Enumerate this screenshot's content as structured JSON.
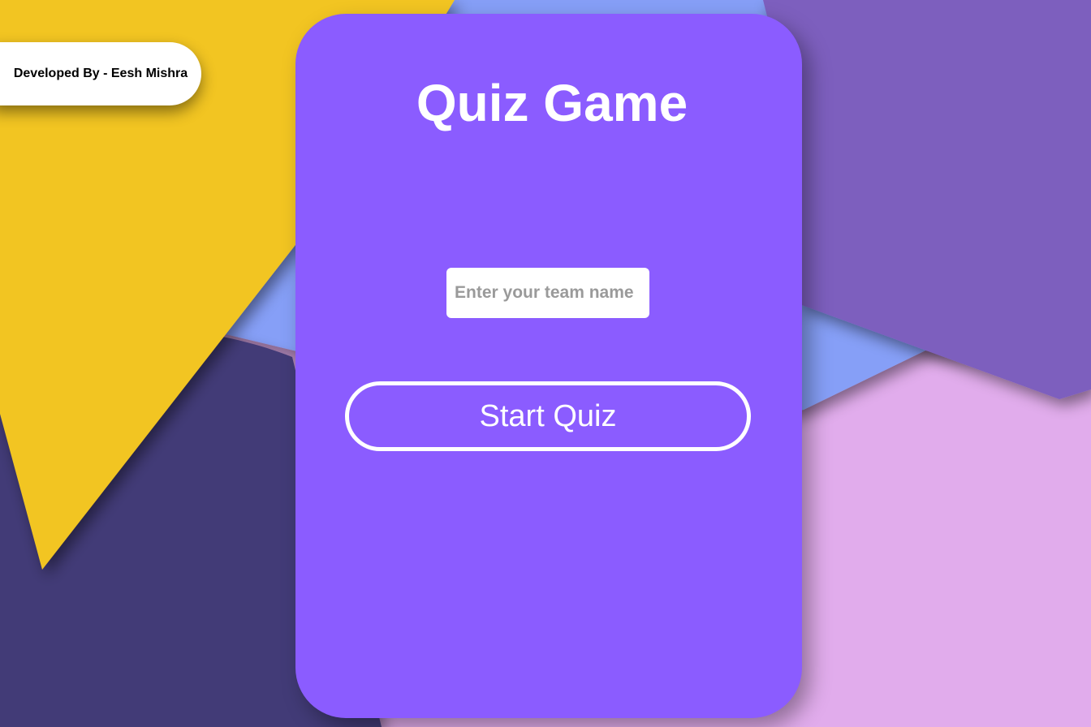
{
  "credit": {
    "text": "Developed By - Eesh Mishra"
  },
  "card": {
    "title": "Quiz Game"
  },
  "team_input": {
    "placeholder": "Enter your team name",
    "value": ""
  },
  "start_button": {
    "label": "Start Quiz"
  },
  "colors": {
    "card": "#8b5cff",
    "yellow_shape": "#f2c521",
    "blue_shape": "#869ff7",
    "dark_purple_shape": "#433a77",
    "violet_shape": "#7d5fbe",
    "pink_background": "#e1acec"
  }
}
